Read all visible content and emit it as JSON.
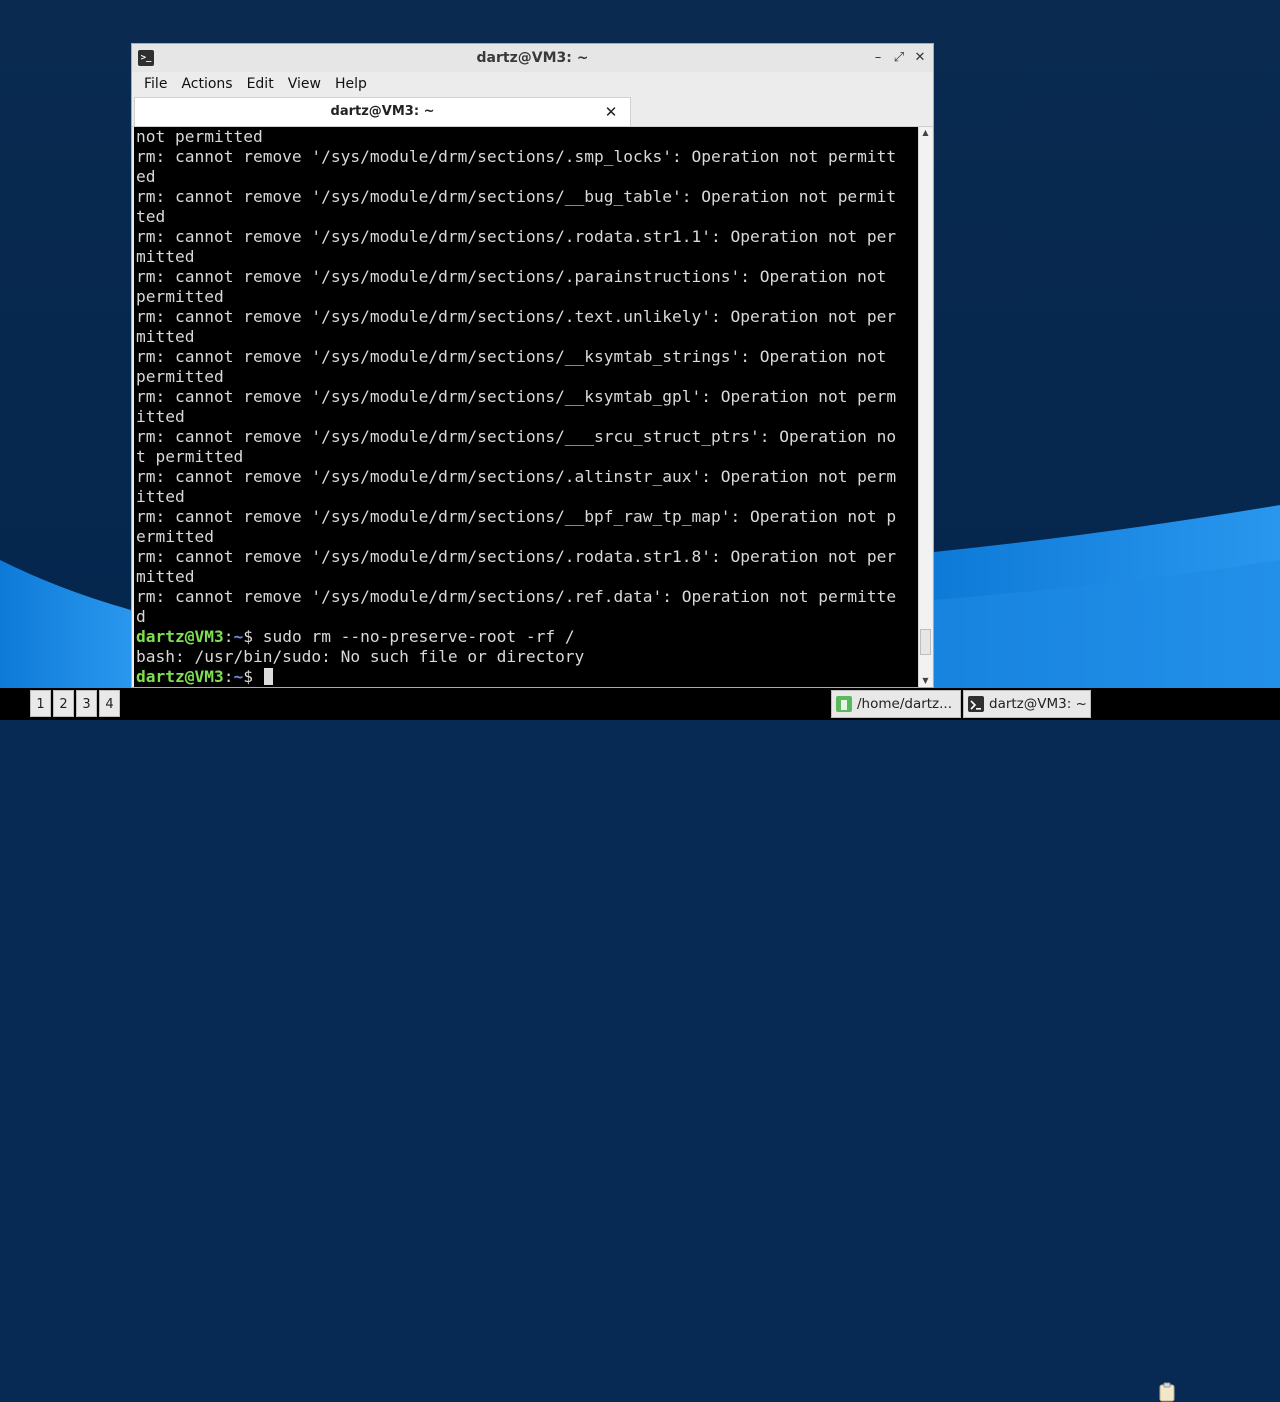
{
  "window": {
    "title": "dartz@VM3: ~",
    "icon_glyph": ">_",
    "controls": {
      "minimize": "–",
      "maximize": "⤢",
      "close": "✕"
    }
  },
  "menu": [
    "File",
    "Actions",
    "Edit",
    "View",
    "Help"
  ],
  "tab": {
    "label": "dartz@VM3: ~",
    "close": "✕"
  },
  "terminal": {
    "lines": [
      "not permitted",
      "rm: cannot remove '/sys/module/drm/sections/.smp_locks': Operation not permitt",
      "ed",
      "rm: cannot remove '/sys/module/drm/sections/__bug_table': Operation not permit",
      "ted",
      "rm: cannot remove '/sys/module/drm/sections/.rodata.str1.1': Operation not per",
      "mitted",
      "rm: cannot remove '/sys/module/drm/sections/.parainstructions': Operation not",
      "permitted",
      "rm: cannot remove '/sys/module/drm/sections/.text.unlikely': Operation not per",
      "mitted",
      "rm: cannot remove '/sys/module/drm/sections/__ksymtab_strings': Operation not",
      "permitted",
      "rm: cannot remove '/sys/module/drm/sections/__ksymtab_gpl': Operation not perm",
      "itted",
      "rm: cannot remove '/sys/module/drm/sections/___srcu_struct_ptrs': Operation no",
      "t permitted",
      "rm: cannot remove '/sys/module/drm/sections/.altinstr_aux': Operation not perm",
      "itted",
      "rm: cannot remove '/sys/module/drm/sections/__bpf_raw_tp_map': Operation not p",
      "ermitted",
      "rm: cannot remove '/sys/module/drm/sections/.rodata.str1.8': Operation not per",
      "mitted",
      "rm: cannot remove '/sys/module/drm/sections/.ref.data': Operation not permitte",
      "d"
    ],
    "prompt_user": "dartz@VM3",
    "prompt_colon": ":",
    "prompt_path": "~",
    "prompt_symbol": "$ ",
    "command": "sudo rm --no-preserve-root -rf /",
    "error_line": "bash: /usr/bin/sudo: No such file or directory"
  },
  "scrollbar": {
    "up": "▲",
    "down": "▼",
    "position": 0.96
  },
  "taskbar": {
    "workspaces": [
      "1",
      "2",
      "3",
      "4"
    ],
    "tasks": [
      {
        "label": "/home/dartz...",
        "icon": "folder-icon"
      },
      {
        "label": "dartz@VM3: ~",
        "icon": "terminal-icon"
      }
    ],
    "tray_icon": "clipboard-icon"
  },
  "colors": {
    "desktop_bg": "#072a55",
    "desktop_wave": "#1a86e0",
    "prompt_user": "#7ee04e",
    "prompt_path": "#6f8fd9",
    "terminal_bg": "#000000",
    "terminal_fg": "#d9d9d9"
  }
}
